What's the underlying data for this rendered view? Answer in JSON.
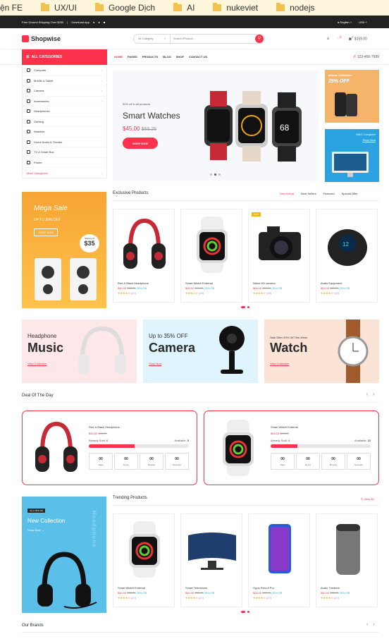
{
  "bookmarks": [
    "ện FE",
    "UX/UI",
    "Google Dịch",
    "AI",
    "nukeviet",
    "nodejs"
  ],
  "topbar": {
    "shipping": "Free Ground Shipping Over $250",
    "download": "Download App",
    "language": "English",
    "currency": "USD"
  },
  "header": {
    "brand": "Shopwise",
    "search_category": "All Category",
    "search_placeholder": "Search Product...",
    "cart_total": "$159.00",
    "wishlist_count": "0",
    "cart_count": "2"
  },
  "nav": {
    "all_categories": "ALL CATEGORIES",
    "links": [
      "HOME",
      "PAGES",
      "PRODUCTS",
      "BLOG",
      "SHOP",
      "CONTACT US"
    ],
    "phone": "123-456-7689"
  },
  "categories": [
    "Computer",
    "Mobile & Tablet",
    "Camera",
    "Accessories",
    "Headphones",
    "Gaming",
    "Watches",
    "Home Audio & Theater",
    "TV & Smart Box",
    "Printer"
  ],
  "more_categories": "More Categories",
  "hero": {
    "small": "50% off in all products",
    "title": "Smart Watches",
    "price": "$45.00",
    "old_price": "$55.25",
    "button": "SHOP NOW"
  },
  "side_banners": [
    {
      "title": "Iphone Collection",
      "offer": "25% OFF"
    },
    {
      "title": "MAC Computer",
      "link": "Shop Now"
    }
  ],
  "promo_mega": {
    "title": "Mega Sale",
    "offer": "UP TO 30% OFF",
    "button": "SHOP NOW",
    "badge_label": "Starting At",
    "badge_price": "$35"
  },
  "exclusive": {
    "title": "Exclusive Products",
    "tabs": [
      "New Arrival",
      "Best Sellers",
      "Featured",
      "Special Offer"
    ]
  },
  "exclusive_products": [
    {
      "name": "Red & Black Headphone",
      "price": "$45.00",
      "old": "$55.25",
      "off": "35% Off",
      "stars": "★★★★☆",
      "reviews": "(21)",
      "new": ""
    },
    {
      "name": "Smart Watch External",
      "price": "$55.00",
      "old": "$95.00",
      "off": "25% Off",
      "stars": "★★★☆☆",
      "reviews": "(15)",
      "new": ""
    },
    {
      "name": "Nikon HD camera",
      "price": "$68.00",
      "old": "$99.00",
      "off": "20% Off",
      "stars": "★★★★☆",
      "reviews": "(25)",
      "new": "NEW"
    },
    {
      "name": "Audio Equipment",
      "price": "$69.00",
      "old": "$89.00",
      "off": "25% Off",
      "stars": "★★★★☆",
      "reviews": "(22)",
      "new": ""
    }
  ],
  "banners": [
    {
      "kicker": "Headphone",
      "big": "Music",
      "link": "View Collection"
    },
    {
      "kicker": "Up to 35% OFF",
      "big": "Camera",
      "link": "Shop Now"
    },
    {
      "kicker": "Sale Offer 20% Off This Week",
      "big": "Watch",
      "link": "View Collection"
    }
  ],
  "deal": {
    "title": "Deal Of The Day"
  },
  "deals": [
    {
      "name": "Red & Black Headphone",
      "price": "$45.00",
      "old": "$55.25",
      "sold_label": "Already Sold:",
      "sold": "6",
      "avail_label": "Available:",
      "avail": "8",
      "progress": 0.46
    },
    {
      "name": "Smart Watch External",
      "price": "$55.00",
      "old": "$95.00",
      "sold_label": "Already Sold:",
      "sold": "4",
      "avail_label": "Available:",
      "avail": "22",
      "progress": 0.27
    }
  ],
  "countdown": [
    {
      "value": "00",
      "label": "Days"
    },
    {
      "value": "00",
      "label": "Hours"
    },
    {
      "value": "00",
      "label": "Minutes"
    },
    {
      "value": "00",
      "label": "Seconds"
    }
  ],
  "trending": {
    "title": "Trending Products",
    "view_all": "View All"
  },
  "trending_products": [
    {
      "name": "Smart Watch External",
      "price": "$45.00",
      "old": "$55.25",
      "off": "35% Off",
      "stars": "★★★★☆",
      "reviews": "(21)"
    },
    {
      "name": "Smart Televisions",
      "price": "$45.00",
      "old": "$55.25",
      "off": "35% Off",
      "stars": "★★★★☆",
      "reviews": "(21)"
    },
    {
      "name": "Oppo Reno3 Pro",
      "price": "$68.00",
      "old": "$99.00",
      "off": "20% Off",
      "stars": "★★★★☆",
      "reviews": "(21)"
    },
    {
      "name": "Audio Theaters",
      "price": "$45.00",
      "old": "$55.25",
      "off": "35% Off",
      "stars": "★★★★☆",
      "reviews": "(21)"
    }
  ],
  "promo_new": {
    "tag": "Up to 50% Off",
    "title": "New Collection",
    "link": "Shop Now →",
    "vertical": "Headphone"
  },
  "brands": {
    "title": "Our Brands"
  }
}
